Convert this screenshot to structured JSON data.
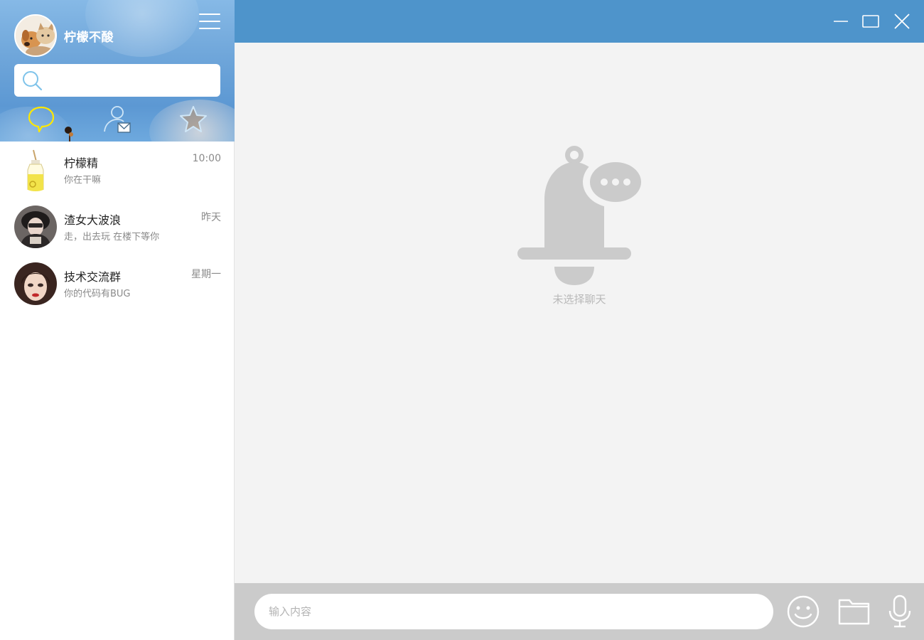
{
  "user": {
    "name": "柠檬不酸"
  },
  "search": {
    "placeholder": ""
  },
  "tabs": [
    {
      "icon": "chat-bubble-icon",
      "active": true,
      "color": "#ffe800"
    },
    {
      "icon": "contact-mail-icon",
      "active": false
    },
    {
      "icon": "star-icon",
      "active": false
    }
  ],
  "chats": [
    {
      "name": "柠檬精",
      "preview": "你在干嘛",
      "time": "10:00"
    },
    {
      "name": "渣女大波浪",
      "preview": "走，出去玩 在楼下等你",
      "time": "昨天"
    },
    {
      "name": "技术交流群",
      "preview": "你的代码有BUG",
      "time": "星期一"
    }
  ],
  "empty_state": {
    "icon": "bell-message-icon",
    "text": "未选择聊天"
  },
  "composer": {
    "placeholder": "输入内容"
  },
  "colors": {
    "topbar": "#4e94cb",
    "bottombar": "#cbcbcb",
    "accent_tab": "#ffe800"
  }
}
